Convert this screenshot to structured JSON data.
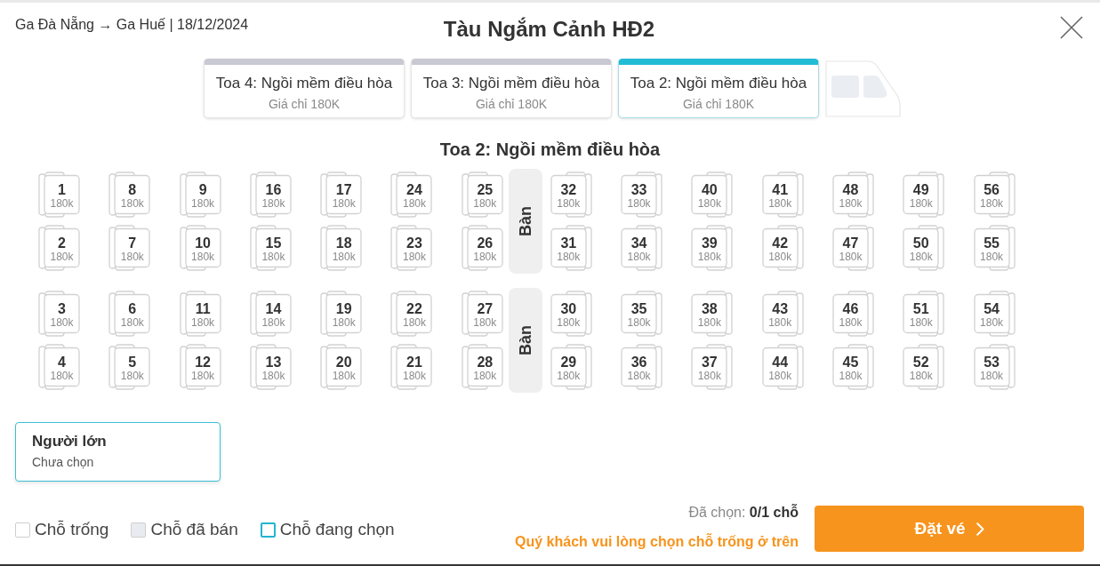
{
  "header": {
    "route": "Ga Đà Nẵng → Ga Huế | 18/12/2024",
    "title": "Tàu Ngắm Cảnh HĐ2"
  },
  "coaches": [
    {
      "name": "Toa 4: Ngồi mềm điều hòa",
      "price": "Giá chỉ 180K",
      "selected": false
    },
    {
      "name": "Toa 3: Ngồi mềm điều hòa",
      "price": "Giá chỉ 180K",
      "selected": false
    },
    {
      "name": "Toa 2: Ngồi mềm điều hòa",
      "price": "Giá chỉ 180K",
      "selected": true
    }
  ],
  "seat_map": {
    "title": "Toa 2: Ngồi mềm điều hòa",
    "sections": [
      {
        "table": "Bàn",
        "rows": [
          {
            "left": [
              {
                "number": "1",
                "price": "180k",
                "selected": false
              },
              {
                "number": "8",
                "price": "180k",
                "selected": false
              },
              {
                "number": "9",
                "price": "180k",
                "selected": false
              },
              {
                "number": "16",
                "price": "180k",
                "selected": false
              },
              {
                "number": "17",
                "price": "180k",
                "selected": false
              },
              {
                "number": "24",
                "price": "180k",
                "selected": false
              },
              {
                "number": "25",
                "price": "180k",
                "selected": false
              }
            ],
            "right": [
              {
                "number": "32",
                "price": "180k",
                "selected": false
              },
              {
                "number": "33",
                "price": "180k",
                "selected": false
              },
              {
                "number": "40",
                "price": "180k",
                "selected": false
              },
              {
                "number": "41",
                "price": "180k",
                "selected": false
              },
              {
                "number": "48",
                "price": "180k",
                "selected": false
              },
              {
                "number": "49",
                "price": "180k",
                "selected": false
              },
              {
                "number": "56",
                "price": "180k",
                "selected": false
              }
            ]
          },
          {
            "left": [
              {
                "number": "2",
                "price": "180k",
                "selected": false
              },
              {
                "number": "7",
                "price": "180k",
                "selected": false
              },
              {
                "number": "10",
                "price": "180k",
                "selected": false
              },
              {
                "number": "15",
                "price": "180k",
                "selected": false
              },
              {
                "number": "18",
                "price": "180k",
                "selected": false
              },
              {
                "number": "23",
                "price": "180k",
                "selected": false
              },
              {
                "number": "26",
                "price": "180k",
                "selected": false
              }
            ],
            "right": [
              {
                "number": "31",
                "price": "180k",
                "selected": false
              },
              {
                "number": "34",
                "price": "180k",
                "selected": false
              },
              {
                "number": "39",
                "price": "180k",
                "selected": false
              },
              {
                "number": "42",
                "price": "180k",
                "selected": false
              },
              {
                "number": "47",
                "price": "180k",
                "selected": false
              },
              {
                "number": "50",
                "price": "180k",
                "selected": false
              },
              {
                "number": "55",
                "price": "180k",
                "selected": false
              }
            ]
          }
        ]
      },
      {
        "table": "Bàn",
        "rows": [
          {
            "left": [
              {
                "number": "3",
                "price": "180k",
                "selected": false
              },
              {
                "number": "6",
                "price": "180k",
                "selected": false
              },
              {
                "number": "11",
                "price": "180k",
                "selected": false
              },
              {
                "number": "14",
                "price": "180k",
                "selected": false
              },
              {
                "number": "19",
                "price": "180k",
                "selected": false
              },
              {
                "number": "22",
                "price": "180k",
                "selected": false
              },
              {
                "number": "27",
                "price": "180k",
                "selected": false
              }
            ],
            "right": [
              {
                "number": "30",
                "price": "180k",
                "selected": false
              },
              {
                "number": "35",
                "price": "180k",
                "selected": false
              },
              {
                "number": "38",
                "price": "180k",
                "selected": false
              },
              {
                "number": "43",
                "price": "180k",
                "selected": false
              },
              {
                "number": "46",
                "price": "180k",
                "selected": false
              },
              {
                "number": "51",
                "price": "180k",
                "selected": false
              },
              {
                "number": "54",
                "price": "180k",
                "selected": false
              }
            ]
          },
          {
            "left": [
              {
                "number": "4",
                "price": "180k",
                "selected": false
              },
              {
                "number": "5",
                "price": "180k",
                "selected": false
              },
              {
                "number": "12",
                "price": "180k",
                "selected": false
              },
              {
                "number": "13",
                "price": "180k",
                "selected": false
              },
              {
                "number": "20",
                "price": "180k",
                "selected": false
              },
              {
                "number": "21",
                "price": "180k",
                "selected": false
              },
              {
                "number": "28",
                "price": "180k",
                "selected": false
              }
            ],
            "right": [
              {
                "number": "29",
                "price": "180k",
                "selected": false
              },
              {
                "number": "36",
                "price": "180k",
                "selected": false
              },
              {
                "number": "37",
                "price": "180k",
                "selected": false
              },
              {
                "number": "44",
                "price": "180k",
                "selected": false
              },
              {
                "number": "45",
                "price": "180k",
                "selected": false
              },
              {
                "number": "52",
                "price": "180k",
                "selected": false
              },
              {
                "number": "53",
                "price": "180k",
                "selected": false
              }
            ]
          }
        ]
      }
    ]
  },
  "passengers": [
    {
      "type": "Người lớn",
      "seat": "Chưa chọn",
      "selected": true
    }
  ],
  "legend": [
    {
      "label": "Chỗ trống",
      "kind": "available"
    },
    {
      "label": "Chỗ đã bán",
      "kind": "sold"
    },
    {
      "label": "Chỗ đang chọn",
      "kind": "selected"
    }
  ],
  "booking": {
    "summary": "Đã chọn: **0/1 chỗ**",
    "hint": "Quý khách vui lòng chọn chỗ trống ở trên",
    "button": "Đặt vé"
  }
}
